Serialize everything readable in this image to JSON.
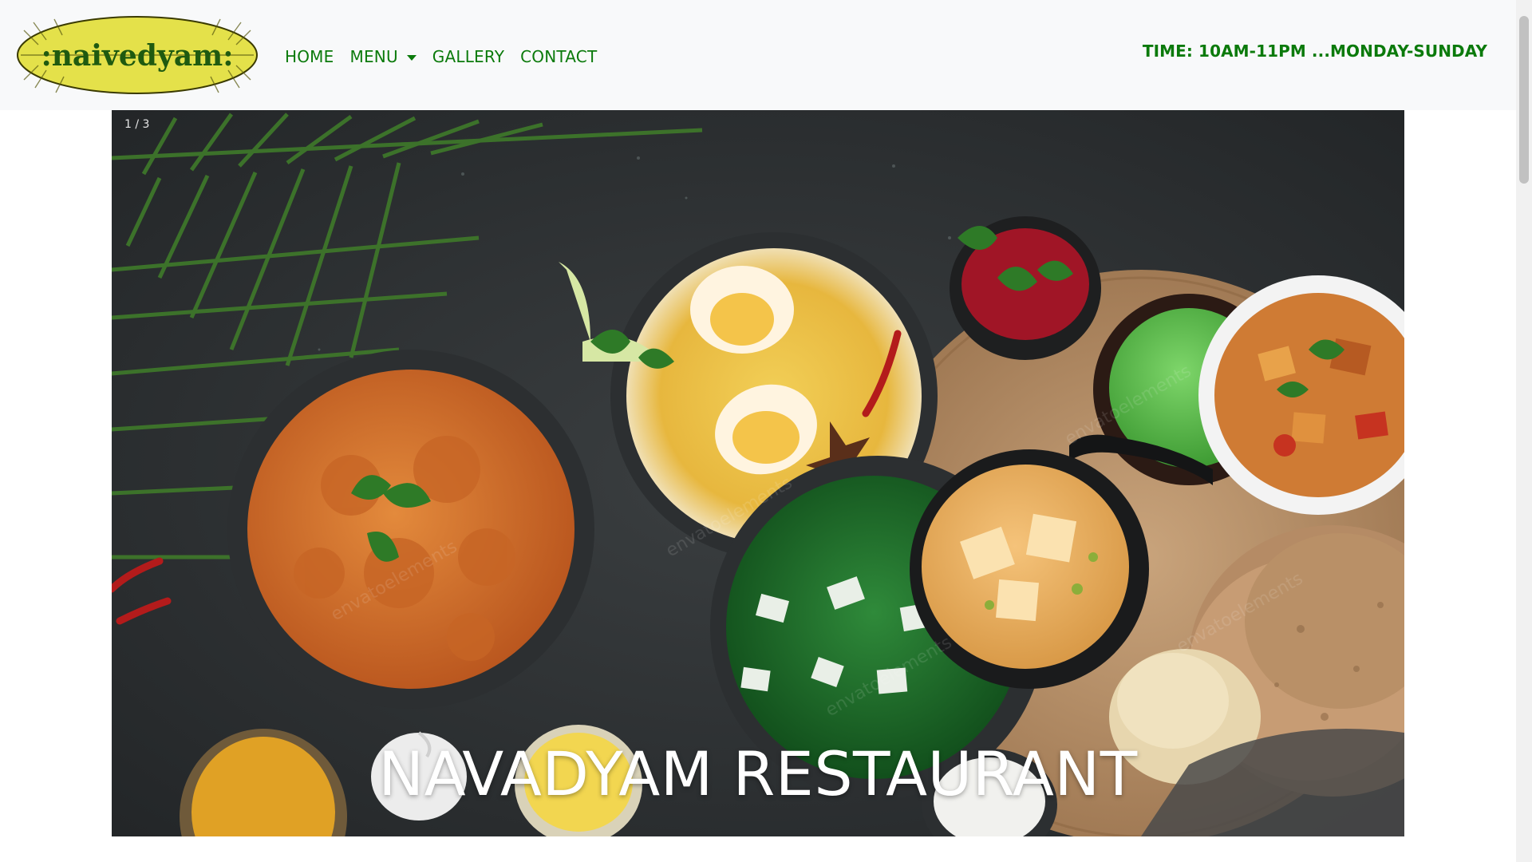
{
  "brand": {
    "logo_text": ":naivedyam:",
    "logo_color": "#e4e14a",
    "accent_color": "#0b7a0b"
  },
  "nav": {
    "items": [
      {
        "label": "HOME"
      },
      {
        "label": "MENU",
        "icon": "caret-down-icon"
      },
      {
        "label": "GALLERY"
      },
      {
        "label": "CONTACT"
      }
    ],
    "hours": "TIME: 10AM-11PM ...MONDAY-SUNDAY"
  },
  "carousel": {
    "counter": "1 / 3",
    "caption": "NAVADYAM RESTAURANT",
    "current_slide": 1,
    "total_slides": 3
  }
}
